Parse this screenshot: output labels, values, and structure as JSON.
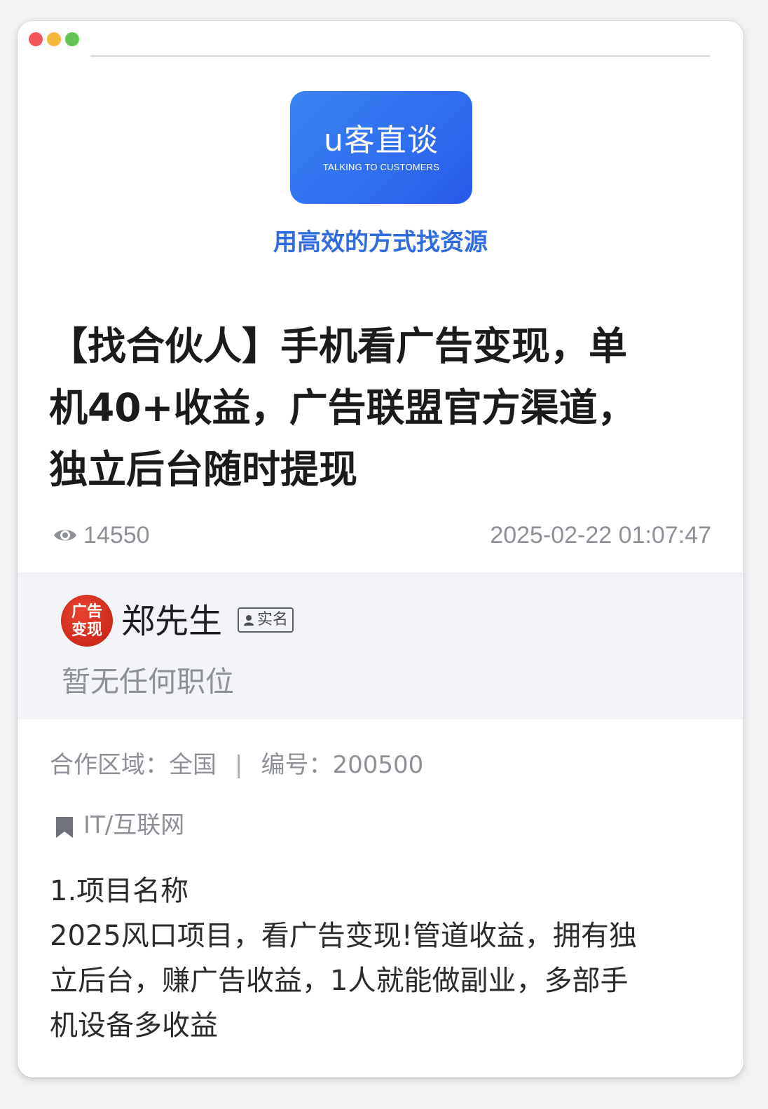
{
  "window": {
    "controls": [
      "close",
      "minimize",
      "maximize"
    ]
  },
  "logo": {
    "main": "u客直谈",
    "sub": "TALKING TO CUSTOMERS"
  },
  "tagline": "用高效的方式找资源",
  "post": {
    "title_lines": [
      "【找合伙人】手机看广告变现，单",
      "机40+收益，广告联盟官方渠道，",
      "独立后台随时提现"
    ],
    "views": "14550",
    "published_at": "2025-02-22 01:07:47"
  },
  "author": {
    "avatar_text_line1": "广告",
    "avatar_text_line2": "变现",
    "name": "郑先生",
    "verified_label": "实名",
    "position": "暂无任何职位"
  },
  "info": {
    "region_label": "合作区域：",
    "region_value": "全国",
    "separator": "|",
    "id_label": "编号：",
    "id_value": "200500"
  },
  "category": "IT/互联网",
  "content": {
    "lines": [
      "1.项目名称",
      "2025风口项目，看广告变现!管道收益，拥有独",
      "立后台，赚广告收益，1人就能做副业，多部手",
      "机设备多收益"
    ]
  },
  "colors": {
    "accent": "#2f6cdf",
    "logo_bg": "#3a84f2",
    "muted_text": "#8e9097",
    "avatar_bg": "#d42c1c"
  },
  "icons": {
    "views": "eye-icon",
    "verified": "person-icon",
    "category": "bookmark-icon"
  }
}
